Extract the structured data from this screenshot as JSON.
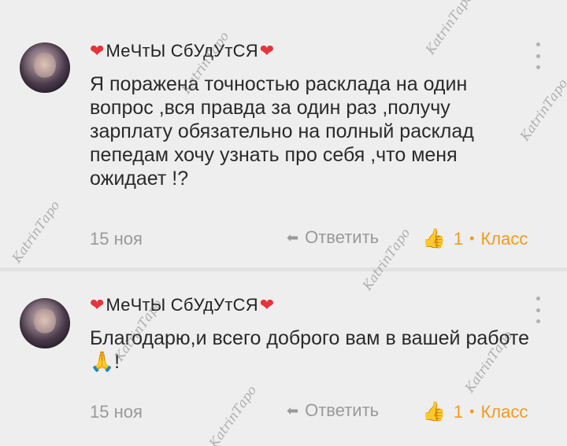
{
  "comments": [
    {
      "author": "МеЧтЫ СбУдУтСЯ",
      "text": "Я поражена точностью расклада на один вопрос ,вся правда за один раз ,получу зарплату обязательно на полный расклад пепедам хочу узнать про себя ,что меня ожидает !?",
      "date": "15 ноя",
      "reply_label": "Ответить",
      "like_count": "1",
      "like_label": "Класс"
    },
    {
      "author": "МеЧтЫ СбУдУтСЯ",
      "text": "Благодарю,и всего доброго вам в вашей работе🙏!",
      "date": "15 ноя",
      "reply_label": "Ответить",
      "like_count": "1",
      "like_label": "Класс"
    }
  ],
  "watermark": "KatrinТаро",
  "icons": {
    "heart": "heart-icon",
    "more": "more-vertical-icon",
    "reply": "reply-arrow-icon",
    "like": "thumbs-up-icon"
  },
  "colors": {
    "background": "#eeeeee",
    "accent": "#f59a1e",
    "heart": "#e8333b",
    "meta_text": "#999999"
  }
}
